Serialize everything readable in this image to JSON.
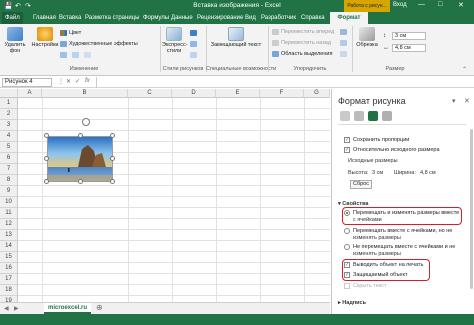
{
  "window": {
    "title": "Вставка изображения - Excel",
    "context_label": "Работа с рисун...",
    "signin": "Вход",
    "colors": {
      "accent": "#217346",
      "context": "#d6a500",
      "highlight": "#d0202a"
    }
  },
  "tabs": [
    "Файл",
    "Главная",
    "Вставка",
    "Разметка страницы",
    "Формулы",
    "Данные",
    "Рецензирование",
    "Вид",
    "Разработчик",
    "Справка",
    "Формат"
  ],
  "ribbon": {
    "remove_bg": "Удалить фон",
    "corrections": "Настройки",
    "color": "Цвет",
    "artistic": "Художественные эффекты",
    "group_change": "Изменение",
    "express_styles": "Экспресс-стили",
    "group_styles": "Стили рисунков",
    "alt_text": "Замещающий текст",
    "group_access": "Специальные возможности",
    "bring_forward": "Переместить вперед",
    "send_backward": "Переместить назад",
    "selection_pane": "Область выделения",
    "group_arrange": "Упорядочить",
    "crop": "Обрезка",
    "height": "3 см",
    "width": "4,8 см",
    "group_size": "Размер"
  },
  "formula_bar": {
    "name_box": "Рисунок 4",
    "fx": "fx"
  },
  "grid": {
    "columns": [
      "A",
      "B",
      "C",
      "D",
      "E",
      "F",
      "G"
    ],
    "rows": [
      "1",
      "2",
      "3",
      "4",
      "5",
      "6",
      "7",
      "8",
      "9",
      "10",
      "11",
      "12",
      "13",
      "14",
      "15",
      "16",
      "17",
      "18",
      "19"
    ]
  },
  "sheet": {
    "name": "microexcel.ru"
  },
  "panel": {
    "title": "Формат рисунка",
    "lock_ratio": "Сохранить пропорции",
    "relative_original": "Относительно исходного размера",
    "original_size": "Исходные размеры",
    "height_label": "Высота:",
    "height_value": "3 см",
    "width_label": "Ширина:",
    "width_value": "4,8 см",
    "reset": "Сброс",
    "properties": "Свойства",
    "move_resize_1": "Перемещать и изменять размеры вместе",
    "move_resize_2": "с ячейками",
    "move_only_1": "Перемещать вместе с ячейками, но не",
    "move_only_2": "изменять размеры",
    "no_move_1": "Не перемещать вместе с ячейками и не",
    "no_move_2": "изменять размеры",
    "print_object": "Выводить объект на печать",
    "locked": "Защищаемый объект",
    "lock_text": "Скрыть текст",
    "alt_text": "Надпись"
  }
}
